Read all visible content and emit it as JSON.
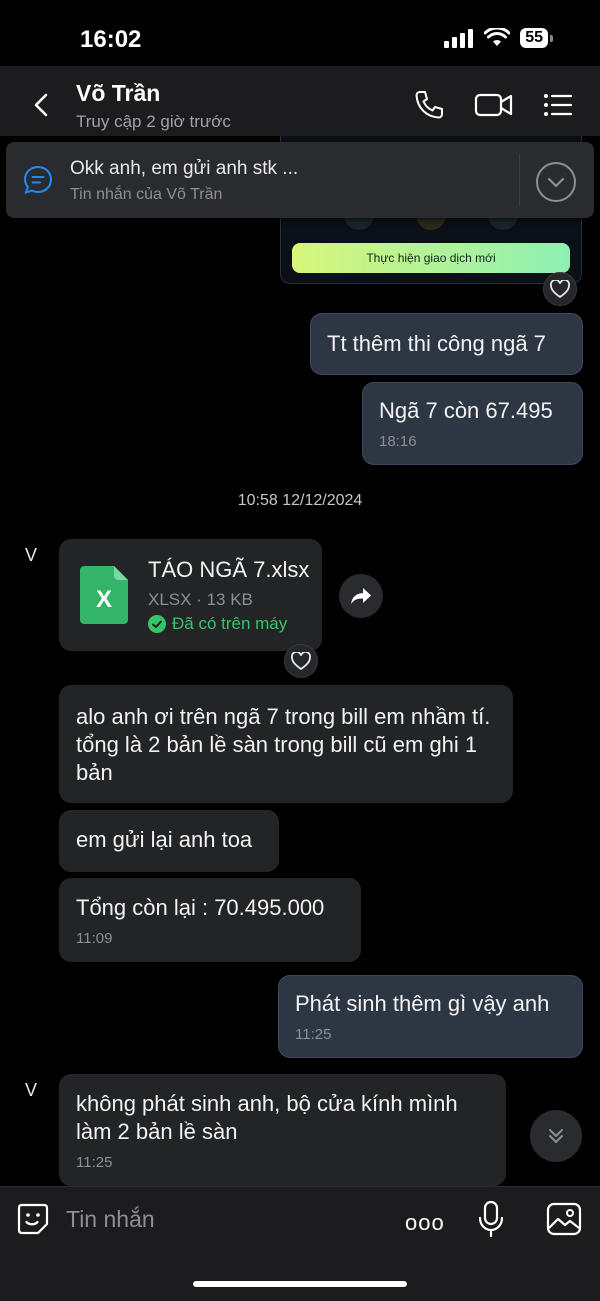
{
  "status": {
    "time": "16:02",
    "battery": "55"
  },
  "header": {
    "contact_name": "Võ Trần",
    "status": "Truy cập 2 giờ trước"
  },
  "pinned": {
    "text": "Okk anh, em gửi anh stk ...",
    "sub": "Tin nhắn của Võ Trần"
  },
  "image_card": {
    "button": "Thực hiện giao dịch mới"
  },
  "messages": {
    "m1": {
      "text": "Tt thêm thi công ngã 7"
    },
    "m2": {
      "text": "Ngã 7 còn 67.495",
      "time": "18:16"
    },
    "date_separator": "10:58 12/12/2024",
    "avatar_initial": "V",
    "file": {
      "name": "TÁO NGÃ 7.xlsx",
      "meta": "XLSX · 13 KB",
      "status": "Đã có trên máy",
      "icon_letter": "X"
    },
    "m3": {
      "text": "alo anh ơi trên ngã 7 trong bill em nhầm tí. tổng là 2 bản lề sàn trong bill cũ em ghi 1 bản"
    },
    "m4": {
      "text": "em gửi lại anh toa"
    },
    "m5": {
      "text": "Tổng còn lại : 70.495.000",
      "time": "11:09"
    },
    "m6": {
      "text": "Phát sinh thêm gì vậy anh",
      "time": "11:25"
    },
    "m7": {
      "text": "không phát sinh anh, bộ cửa kính mình làm 2 bản lề sàn",
      "time": "11:25"
    }
  },
  "input": {
    "placeholder": "Tin nhắn",
    "more": "ooo"
  },
  "colors": {
    "background": "#000000",
    "outgoing_bubble": "#2d3643",
    "incoming_bubble": "#232426",
    "accent": "#1e8cff",
    "success": "#35c46a"
  }
}
